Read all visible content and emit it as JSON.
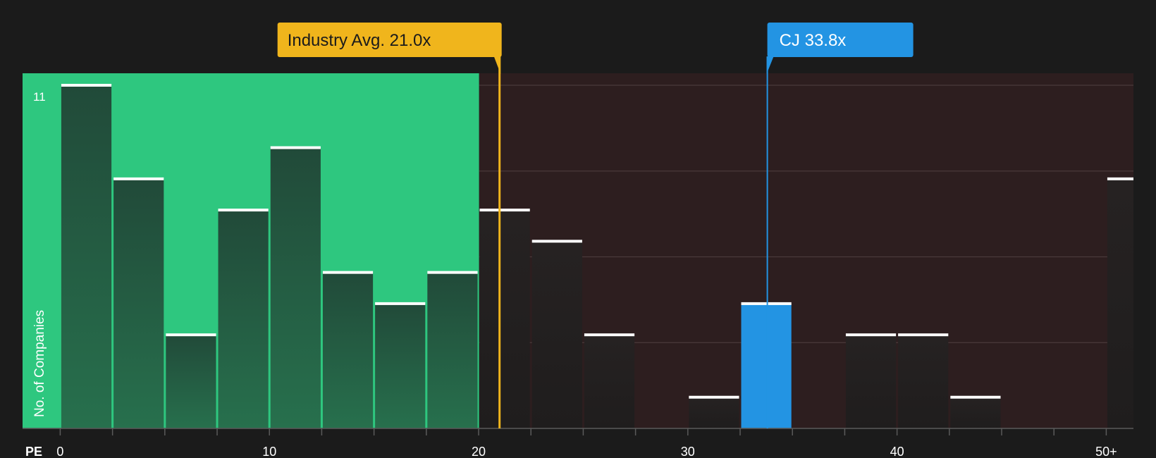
{
  "chart_data": {
    "type": "bar",
    "title": "",
    "xlabel": "PE",
    "ylabel": "No. of Companies",
    "x_tick_labels": [
      {
        "value": 0,
        "label": "0"
      },
      {
        "value": 10,
        "label": "10"
      },
      {
        "value": 20,
        "label": "20"
      },
      {
        "value": 30,
        "label": "30"
      },
      {
        "value": 40,
        "label": "40"
      },
      {
        "value": 50,
        "label": "50+"
      }
    ],
    "y_top_label": "11",
    "ylim": [
      0,
      11
    ],
    "xlim": [
      -1.8,
      51.3
    ],
    "bin_width": 2.5,
    "bins": [
      {
        "x0": 0,
        "value": 11
      },
      {
        "x0": 2.5,
        "value": 8
      },
      {
        "x0": 5,
        "value": 3
      },
      {
        "x0": 7.5,
        "value": 7
      },
      {
        "x0": 10,
        "value": 9
      },
      {
        "x0": 12.5,
        "value": 5
      },
      {
        "x0": 15,
        "value": 4
      },
      {
        "x0": 17.5,
        "value": 5
      },
      {
        "x0": 20,
        "value": 7
      },
      {
        "x0": 22.5,
        "value": 6
      },
      {
        "x0": 25,
        "value": 3
      },
      {
        "x0": 27.5,
        "value": 0
      },
      {
        "x0": 30,
        "value": 1
      },
      {
        "x0": 32.5,
        "value": 4,
        "highlight": true
      },
      {
        "x0": 35,
        "value": 0
      },
      {
        "x0": 37.5,
        "value": 3
      },
      {
        "x0": 40,
        "value": 3
      },
      {
        "x0": 42.5,
        "value": 1
      },
      {
        "x0": 45,
        "value": 0
      },
      {
        "x0": 47.5,
        "value": 0
      },
      {
        "x0": 50,
        "value": 8
      }
    ],
    "markers": [
      {
        "name": "industry",
        "label": "Industry Avg. 21.0x",
        "value": 21.0,
        "color": "#f0b51c"
      },
      {
        "name": "company",
        "label": "CJ 33.8x",
        "value": 33.8,
        "color": "#2394e3"
      }
    ],
    "colors": {
      "below_zone": "#2ec77f",
      "above_zone": "#2d1e1f",
      "bar_dark": "#232323",
      "bar_highlight": "#2394e3",
      "bar_cap": "#ffffff"
    }
  }
}
